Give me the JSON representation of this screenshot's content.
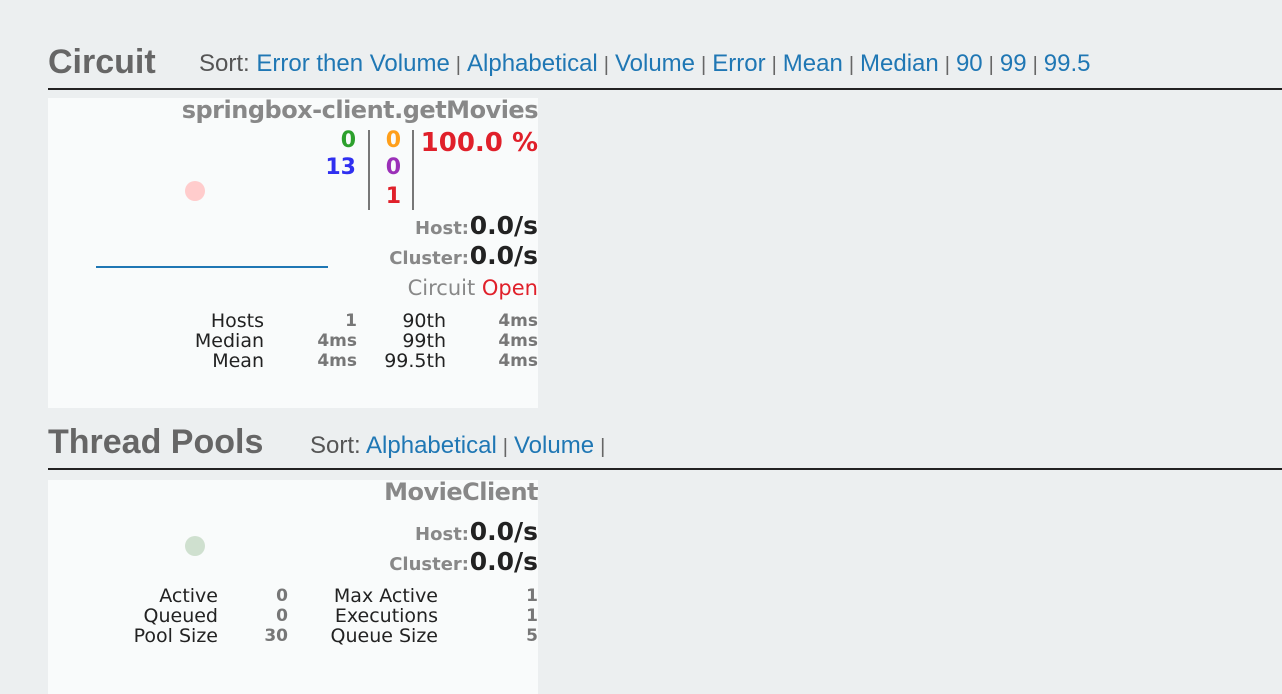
{
  "circuit_section": {
    "title": "Circuit",
    "sort_label": "Sort:",
    "sort_options": [
      "Error then Volume",
      "Alphabetical",
      "Volume",
      "Error",
      "Mean",
      "Median",
      "90",
      "99",
      "99.5"
    ]
  },
  "circuit_card": {
    "name": "springbox-client.getMovies",
    "success": "0",
    "short_circuited": "13",
    "timeout": "0",
    "rejected": "0",
    "failure": "1",
    "error_percent": "100.0 %",
    "host_label": "Host:",
    "host_rate": "0.0/s",
    "cluster_label": "Cluster:",
    "cluster_rate": "0.0/s",
    "circuit_label": "Circuit",
    "circuit_status": "Open",
    "stats": {
      "hosts_label": "Hosts",
      "hosts_value": "1",
      "median_label": "Median",
      "median_value": "4ms",
      "mean_label": "Mean",
      "mean_value": "4ms",
      "p90_label": "90th",
      "p90_value": "4ms",
      "p99_label": "99th",
      "p99_value": "4ms",
      "p995_label": "99.5th",
      "p995_value": "4ms"
    },
    "colors": {
      "success": "#2ca02c",
      "short_circuited": "#2f2ff0",
      "timeout": "#ff9f1a",
      "rejected": "#9b30b8",
      "failure": "#e0202a",
      "error_percent": "#e0202a",
      "status_dot": "#ffcccc",
      "sparkline": "#1f77b4"
    }
  },
  "thread_section": {
    "title": "Thread Pools",
    "sort_label": "Sort:",
    "sort_options": [
      "Alphabetical",
      "Volume"
    ]
  },
  "thread_card": {
    "name": "MovieClient",
    "host_label": "Host:",
    "host_rate": "0.0/s",
    "cluster_label": "Cluster:",
    "cluster_rate": "0.0/s",
    "stats": {
      "active_label": "Active",
      "active_value": "0",
      "queued_label": "Queued",
      "queued_value": "0",
      "pool_size_label": "Pool Size",
      "pool_size_value": "30",
      "max_active_label": "Max Active",
      "max_active_value": "1",
      "executions_label": "Executions",
      "executions_value": "1",
      "queue_size_label": "Queue Size",
      "queue_size_value": "5"
    },
    "colors": {
      "status_dot": "#cfe0cf"
    }
  }
}
